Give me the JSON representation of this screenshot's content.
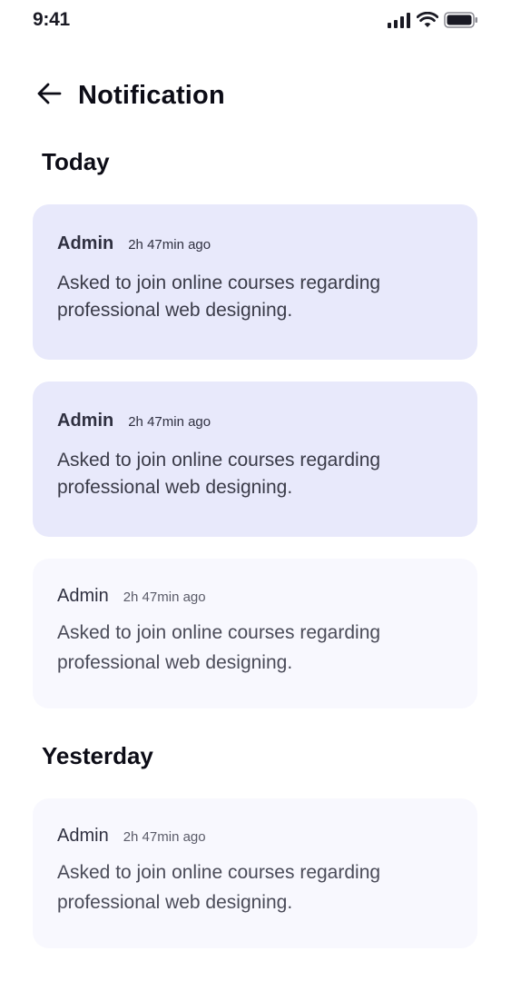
{
  "status_bar": {
    "time": "9:41",
    "icons": [
      "signal-icon",
      "wifi-icon",
      "battery-icon"
    ]
  },
  "header": {
    "back_icon": "arrow-left-icon",
    "title": "Notification"
  },
  "sections": {
    "today": "Today",
    "yesterday": "Yesterday"
  },
  "notifications": [
    {
      "sender": "Admin",
      "time": "2h 47min ago",
      "message": "Asked to join online courses regarding professional web designing.",
      "state": "unread"
    },
    {
      "sender": "Admin",
      "time": "2h 47min ago",
      "message": "Asked to join online courses regarding professional web designing.",
      "state": "unread"
    },
    {
      "sender": "Admin",
      "time": "2h 47min ago",
      "message": "Asked to join online courses regarding professional web designing.",
      "state": "read"
    },
    {
      "sender": "Admin",
      "time": "2h 47min ago",
      "message": "Asked to join online courses regarding professional web designing.",
      "state": "read"
    }
  ],
  "colors": {
    "unread_card": "#e8e9fb",
    "read_card": "#f8f8fe",
    "text_primary": "#0c0c16"
  }
}
